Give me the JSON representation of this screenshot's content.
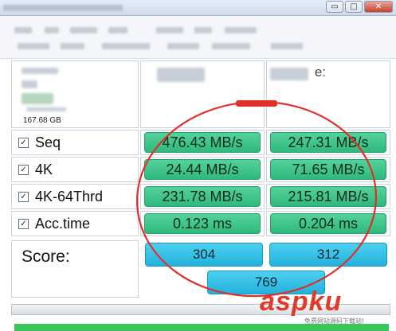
{
  "window": {
    "minimize_glyph": "▭",
    "maximize_glyph": "□",
    "close_glyph": "✕"
  },
  "drive": {
    "capacity": "167.68 GB"
  },
  "columns": {
    "write_suffix": "e:"
  },
  "rows": [
    {
      "label": "Seq",
      "checked": "✓",
      "read": "476.43 MB/s",
      "write": "247.31 MB/s"
    },
    {
      "label": "4K",
      "checked": "✓",
      "read": "24.44 MB/s",
      "write": "71.65 MB/s"
    },
    {
      "label": "4K-64Thrd",
      "checked": "✓",
      "read": "231.78 MB/s",
      "write": "215.81 MB/s"
    },
    {
      "label": "Acc.time",
      "checked": "✓",
      "read": "0.123 ms",
      "write": "0.204 ms"
    }
  ],
  "score": {
    "label": "Score:",
    "read": "304",
    "write": "312",
    "total": "769"
  },
  "watermark": {
    "brand": "aspku",
    "subtitle": "免费网站源码下载站!"
  },
  "colors": {
    "result_green": "#3cc58a",
    "score_blue": "#2cbbe3",
    "annotation_red": "#e0302a",
    "watermark_red": "#e23a2a"
  }
}
